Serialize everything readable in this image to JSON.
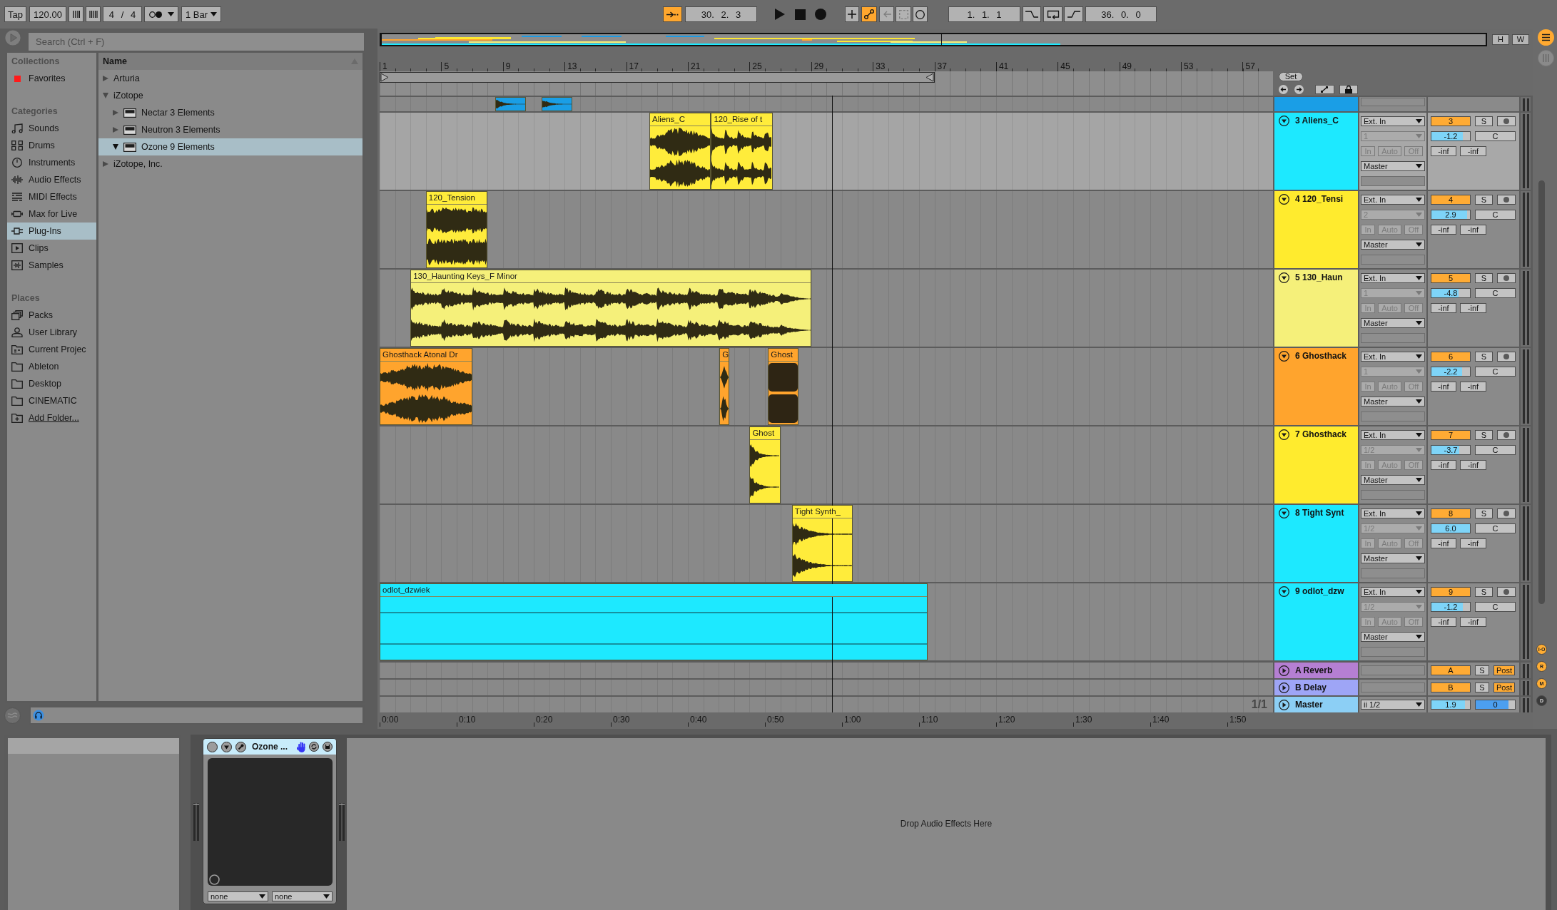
{
  "control_bar": {
    "tap": "Tap",
    "tempo": "120.00",
    "time_signature": "4 / 4",
    "quantization": "1 Bar",
    "follow": {
      "on": true
    },
    "position": "30. 2. 3",
    "record_buttons": [
      {
        "kind": "overdub",
        "on": false,
        "disabled": false
      },
      {
        "kind": "automation-arm",
        "on": true,
        "disabled": false
      },
      {
        "kind": "reenable-automation",
        "on": false,
        "disabled": true
      },
      {
        "kind": "capture",
        "on": false,
        "disabled": true
      },
      {
        "kind": "session-record",
        "on": false,
        "disabled": false
      }
    ],
    "loop_start": "1. 1. 1",
    "loop_buttons": [
      {
        "kind": "punch-in",
        "on": false
      },
      {
        "kind": "loop",
        "on": false
      },
      {
        "kind": "punch-out",
        "on": false
      }
    ],
    "loop_length": "36. 0. 0"
  },
  "browser": {
    "search": {
      "placeholder": "Search (Ctrl + F)"
    },
    "sections": [
      {
        "heading": "Collections",
        "items": [
          {
            "label": "Favorites",
            "color": "#ff1a1a",
            "selected": false
          }
        ]
      },
      {
        "heading": "Categories",
        "items": [
          {
            "label": "Sounds",
            "selected": false
          },
          {
            "label": "Drums",
            "selected": false
          },
          {
            "label": "Instruments",
            "selected": false
          },
          {
            "label": "Audio Effects",
            "selected": false
          },
          {
            "label": "MIDI Effects",
            "selected": false
          },
          {
            "label": "Max for Live",
            "selected": false
          },
          {
            "label": "Plug-Ins",
            "selected": true
          },
          {
            "label": "Clips",
            "selected": false
          },
          {
            "label": "Samples",
            "selected": false
          }
        ]
      },
      {
        "heading": "Places",
        "items": [
          {
            "label": "Packs",
            "selected": false
          },
          {
            "label": "User Library",
            "selected": false
          },
          {
            "label": "Current Projec",
            "selected": false
          },
          {
            "label": "Ableton",
            "selected": false
          },
          {
            "label": "Desktop",
            "selected": false
          },
          {
            "label": "CINEMATIC",
            "selected": false
          }
        ],
        "link": "Add Folder..."
      }
    ],
    "name_column": "Name",
    "tree": [
      {
        "label": "Arturia",
        "expanded": false,
        "selected": false
      },
      {
        "label": "iZotope",
        "expanded": true,
        "selected": false,
        "children": [
          {
            "label": "Nectar 3 Elements",
            "kind": "plugin",
            "expanded": false,
            "selected": false
          },
          {
            "label": "Neutron 3 Elements",
            "kind": "plugin",
            "expanded": false,
            "selected": false
          },
          {
            "label": "Ozone 9 Elements",
            "kind": "plugin",
            "expanded": true,
            "selected": true
          }
        ]
      },
      {
        "label": "iZotope, Inc.",
        "expanded": false,
        "selected": false
      }
    ]
  },
  "arrangement": {
    "view_buttons": [
      "H",
      "W"
    ],
    "bar_numbers": [
      "1",
      "5",
      "9",
      "13",
      "17",
      "21",
      "25",
      "29",
      "33",
      "37",
      "41",
      "45",
      "49",
      "53",
      "57"
    ],
    "set_button": "Set",
    "tracks": [
      {
        "kind": "partial",
        "color": "#1a9ee6",
        "selected": false,
        "clips": [
          {
            "color": "#1a9ee6"
          },
          {
            "color": "#1a9ee6"
          }
        ]
      },
      {
        "kind": "audio",
        "name": "3 Aliens_C",
        "color": "#1de9ff",
        "selected": true,
        "expanded": true,
        "clips": [
          {
            "name": "Aliens_C",
            "color": "#ffec3b"
          },
          {
            "name": "120_Rise of t",
            "color": "#ffec3b"
          }
        ],
        "input": "Ext. In",
        "input_channel": {
          "value": "1",
          "disabled": true
        },
        "monitoring": {
          "options": [
            "In",
            "Auto",
            "Off"
          ],
          "disabled": true
        },
        "output": "Master",
        "number": {
          "label": "3",
          "on": true
        },
        "solo": {
          "label": "S",
          "on": false
        },
        "armed": false,
        "volume": {
          "value": "-1.2",
          "level": 0.82
        },
        "pan": "C",
        "sends": [
          "-inf",
          "-inf"
        ]
      },
      {
        "kind": "audio",
        "name": "4 120_Tensi",
        "color": "#ffeb2e",
        "selected": false,
        "expanded": true,
        "clips": [
          {
            "name": "120_Tension",
            "color": "#ffec3b"
          }
        ],
        "input": "Ext. In",
        "input_channel": {
          "value": "2",
          "disabled": true
        },
        "monitoring": {
          "options": [
            "In",
            "Auto",
            "Off"
          ],
          "disabled": true
        },
        "output": "Master",
        "number": {
          "label": "4",
          "on": true
        },
        "solo": {
          "label": "S",
          "on": false
        },
        "armed": false,
        "volume": {
          "value": "2.9",
          "level": 0.93
        },
        "pan": "C",
        "sends": [
          "-inf",
          "-inf"
        ]
      },
      {
        "kind": "audio",
        "name": "5 130_Haun",
        "color": "#f5f07a",
        "selected": false,
        "expanded": true,
        "clips": [
          {
            "name": "130_Haunting Keys_F Minor",
            "color": "#f5f07a"
          }
        ],
        "input": "Ext. In",
        "input_channel": {
          "value": "1",
          "disabled": true
        },
        "monitoring": {
          "options": [
            "In",
            "Auto",
            "Off"
          ],
          "disabled": true
        },
        "output": "Master",
        "number": {
          "label": "5",
          "on": true
        },
        "solo": {
          "label": "S",
          "on": false
        },
        "armed": false,
        "volume": {
          "value": "-4.8",
          "level": 0.7
        },
        "pan": "C",
        "sends": [
          "-inf",
          "-inf"
        ]
      },
      {
        "kind": "audio",
        "name": "6 Ghosthack",
        "color": "#ffa42d",
        "selected": false,
        "expanded": true,
        "clips": [
          {
            "name": "Ghosthack Atonal Dr",
            "color": "#ffa42d"
          },
          {
            "name": "G",
            "color": "#ffa42d"
          },
          {
            "name": "Ghost",
            "color": "#ffa42d"
          }
        ],
        "input": "Ext. In",
        "input_channel": {
          "value": "1",
          "disabled": true
        },
        "monitoring": {
          "options": [
            "In",
            "Auto",
            "Off"
          ],
          "disabled": true
        },
        "output": "Master",
        "number": {
          "label": "6",
          "on": true
        },
        "solo": {
          "label": "S",
          "on": false
        },
        "armed": false,
        "volume": {
          "value": "-2.2",
          "level": 0.79
        },
        "pan": "C",
        "sends": [
          "-inf",
          "-inf"
        ]
      },
      {
        "kind": "audio",
        "name": "7 Ghosthack",
        "color": "#ffeb2e",
        "selected": false,
        "expanded": true,
        "clips": [
          {
            "name": "Ghost",
            "color": "#ffec3b"
          }
        ],
        "input": "Ext. In",
        "input_channel": {
          "value": "1/2",
          "disabled": true
        },
        "monitoring": {
          "options": [
            "In",
            "Auto",
            "Off"
          ],
          "disabled": true
        },
        "output": "Master",
        "number": {
          "label": "7",
          "on": true
        },
        "solo": {
          "label": "S",
          "on": false
        },
        "armed": false,
        "volume": {
          "value": "-3.7",
          "level": 0.73
        },
        "pan": "C",
        "sends": [
          "-inf",
          "-inf"
        ]
      },
      {
        "kind": "audio",
        "name": "8 Tight Synt",
        "color": "#1de9ff",
        "selected": false,
        "expanded": true,
        "clips": [
          {
            "name": "Tight Synth_",
            "color": "#ffec3b"
          }
        ],
        "input": "Ext. In",
        "input_channel": {
          "value": "1/2",
          "disabled": true
        },
        "monitoring": {
          "options": [
            "In",
            "Auto",
            "Off"
          ],
          "disabled": true
        },
        "output": "Master",
        "number": {
          "label": "8",
          "on": true
        },
        "solo": {
          "label": "S",
          "on": false
        },
        "armed": false,
        "volume": {
          "value": "6.0",
          "level": 1
        },
        "pan": "C",
        "sends": [
          "-inf",
          "-inf"
        ]
      },
      {
        "kind": "audio",
        "name": "9 odlot_dzw",
        "color": "#1de9ff",
        "selected": false,
        "expanded": true,
        "clips": [
          {
            "name": "odlot_dzwiek",
            "color": "#1de9ff"
          }
        ],
        "input": "Ext. In",
        "input_channel": {
          "value": "1/2",
          "disabled": true
        },
        "monitoring": {
          "options": [
            "In",
            "Auto",
            "Off"
          ],
          "disabled": true
        },
        "output": "Master",
        "number": {
          "label": "9",
          "on": true
        },
        "solo": {
          "label": "S",
          "on": false
        },
        "armed": false,
        "volume": {
          "value": "-1.2",
          "level": 0.82
        },
        "pan": "C",
        "sends": [
          "-inf",
          "-inf"
        ]
      }
    ],
    "returns": [
      {
        "name": "A Reverb",
        "color": "#b57fd3",
        "expanded": false,
        "number": {
          "label": "A",
          "on": true
        },
        "solo": {
          "label": "S",
          "on": false
        },
        "post": {
          "label": "Post",
          "on": true
        }
      },
      {
        "name": "B Delay",
        "color": "#9ea5f6",
        "expanded": false,
        "number": {
          "label": "B",
          "on": true
        },
        "solo": {
          "label": "S",
          "on": false
        },
        "post": {
          "label": "Post",
          "on": true
        }
      }
    ],
    "master": {
      "name": "Master",
      "color": "#8ccff5",
      "expanded": false,
      "output": "ii 1/2",
      "volume": {
        "value": "1.9",
        "level": 0.87
      },
      "pan": {
        "value": "0",
        "level": 0.84
      }
    },
    "page_indicator": "1/1",
    "time_labels": [
      "0:00",
      "0:10",
      "0:20",
      "0:30",
      "0:40",
      "0:50",
      "1:00",
      "1:10",
      "1:20",
      "1:30",
      "1:40",
      "1:50"
    ]
  },
  "section_toggles": [
    {
      "label": "I·O",
      "on": true
    },
    {
      "label": "R",
      "on": true
    },
    {
      "label": "M",
      "on": true
    },
    {
      "label": "D",
      "on": false
    }
  ],
  "device_view": {
    "devices": [
      {
        "title": "Ozone ...",
        "presets": [
          "none",
          "none"
        ]
      }
    ],
    "drop_hint": "Drop Audio Effects Here"
  }
}
